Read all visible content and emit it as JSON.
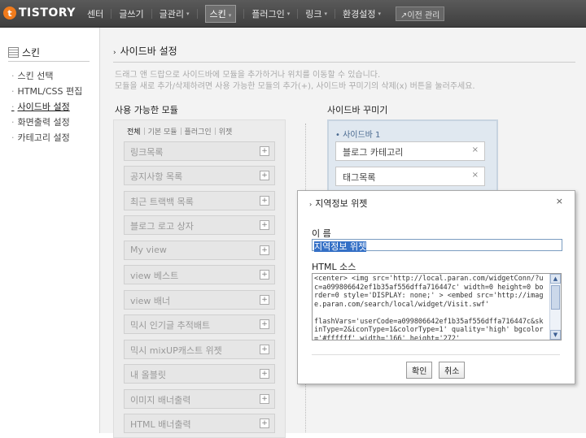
{
  "brand": {
    "logo_mark": "t",
    "name": "TISTORY",
    "accent": "#f07b1c"
  },
  "topnav": {
    "items": [
      {
        "label": "센터",
        "caret": ""
      },
      {
        "label": "글쓰기",
        "caret": ""
      },
      {
        "label": "글관리",
        "caret": "▾"
      },
      {
        "label": "스킨",
        "caret": "▾"
      },
      {
        "label": "플러그인",
        "caret": "▾"
      },
      {
        "label": "링크",
        "caret": "▾"
      },
      {
        "label": "환경설정",
        "caret": "▾"
      }
    ],
    "old_admin": "↗이전 관리"
  },
  "sidebar": {
    "title": "스킨",
    "items": [
      "스킨 선택",
      "HTML/CSS 편집",
      "사이드바 설정",
      "화면출력 설정",
      "카테고리 설정"
    ]
  },
  "main": {
    "title_arrow": "›",
    "title": "사이드바 설정",
    "desc1": "드래그 앤 드랍으로 사이드바에 모듈을 추가하거나 위치를 이동할 수 있습니다.",
    "desc2": "모듈을 새로 추가/삭제하려면 사용 가능한 모듈의 추가(+), 사이드바 꾸미기의 삭제(x) 버튼을 눌러주세요.",
    "available": {
      "title": "사용 가능한 모듈",
      "filters": [
        "전체",
        "기본 모듈",
        "플러그인",
        "위젯"
      ],
      "modules": [
        "링크목록",
        "공지사항 목록",
        "최근 트랙백 목록",
        "블로그 로고 상자",
        "My view",
        "view 베스트",
        "view 배너",
        "믹시 인기글 추적배트",
        "믹시 mixUP캐스트 위젯",
        "내 올블릿",
        "이미지 배너출력",
        "HTML 배너출력"
      ],
      "plus": "+"
    },
    "decorate": {
      "title": "사이드바 꾸미기",
      "group": "사이드바 1",
      "items": [
        "블로그 카테고리",
        "태그목록"
      ],
      "remove": "×"
    }
  },
  "dialog": {
    "title_arrow": "›",
    "title": "지역정보 위젯",
    "close": "×",
    "name_label": "이 름",
    "name_value": "지역정보 위젯",
    "html_label": "HTML 소스",
    "html_source": "<center> <img src='http://local.paran.com/widgetConn/?uc=a099806642ef1b35af556dffa716447c' width=0 height=0 border=0 style='DISPLAY: none;' > <embed src='http://image.paran.com/search/local/widget/Visit.swf'\n\nflashVars='userCode=a099806642ef1b35af556dffa716447c&skinType=2&iconType=1&colorType=1' quality='high' bgcolor='#ffffff' width='166' height='272'",
    "ok": "확인",
    "cancel": "취소"
  }
}
